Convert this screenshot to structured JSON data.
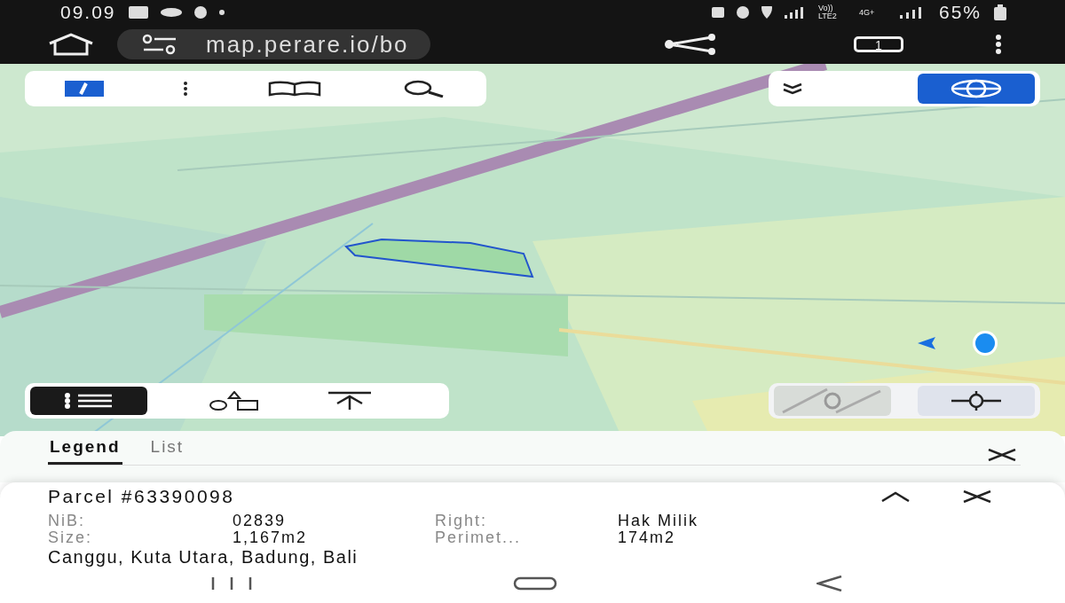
{
  "status_bar": {
    "time": "09.09",
    "network": "Vo)) LTE2",
    "network_2": "4G+",
    "battery": "65%"
  },
  "browser": {
    "url": "map.perare.io/bo",
    "tab_count": "1"
  },
  "layer_toggle": {
    "selected": true
  },
  "list_toggle": {
    "selected": true
  },
  "legend_panel": {
    "tabs": [
      {
        "label": "Legend",
        "selected": true
      },
      {
        "label": "List",
        "selected": false
      }
    ]
  },
  "parcel": {
    "title": "Parcel #63390098",
    "fields": [
      {
        "label": "NiB:",
        "value": "02839"
      },
      {
        "label": "Right:",
        "value": "Hak Milik"
      },
      {
        "label": "Size:",
        "value": "1,167m2"
      },
      {
        "label": "Perimet...",
        "value": "174m2"
      }
    ],
    "address": "Canggu, Kuta Utara, Badung, Bali"
  }
}
